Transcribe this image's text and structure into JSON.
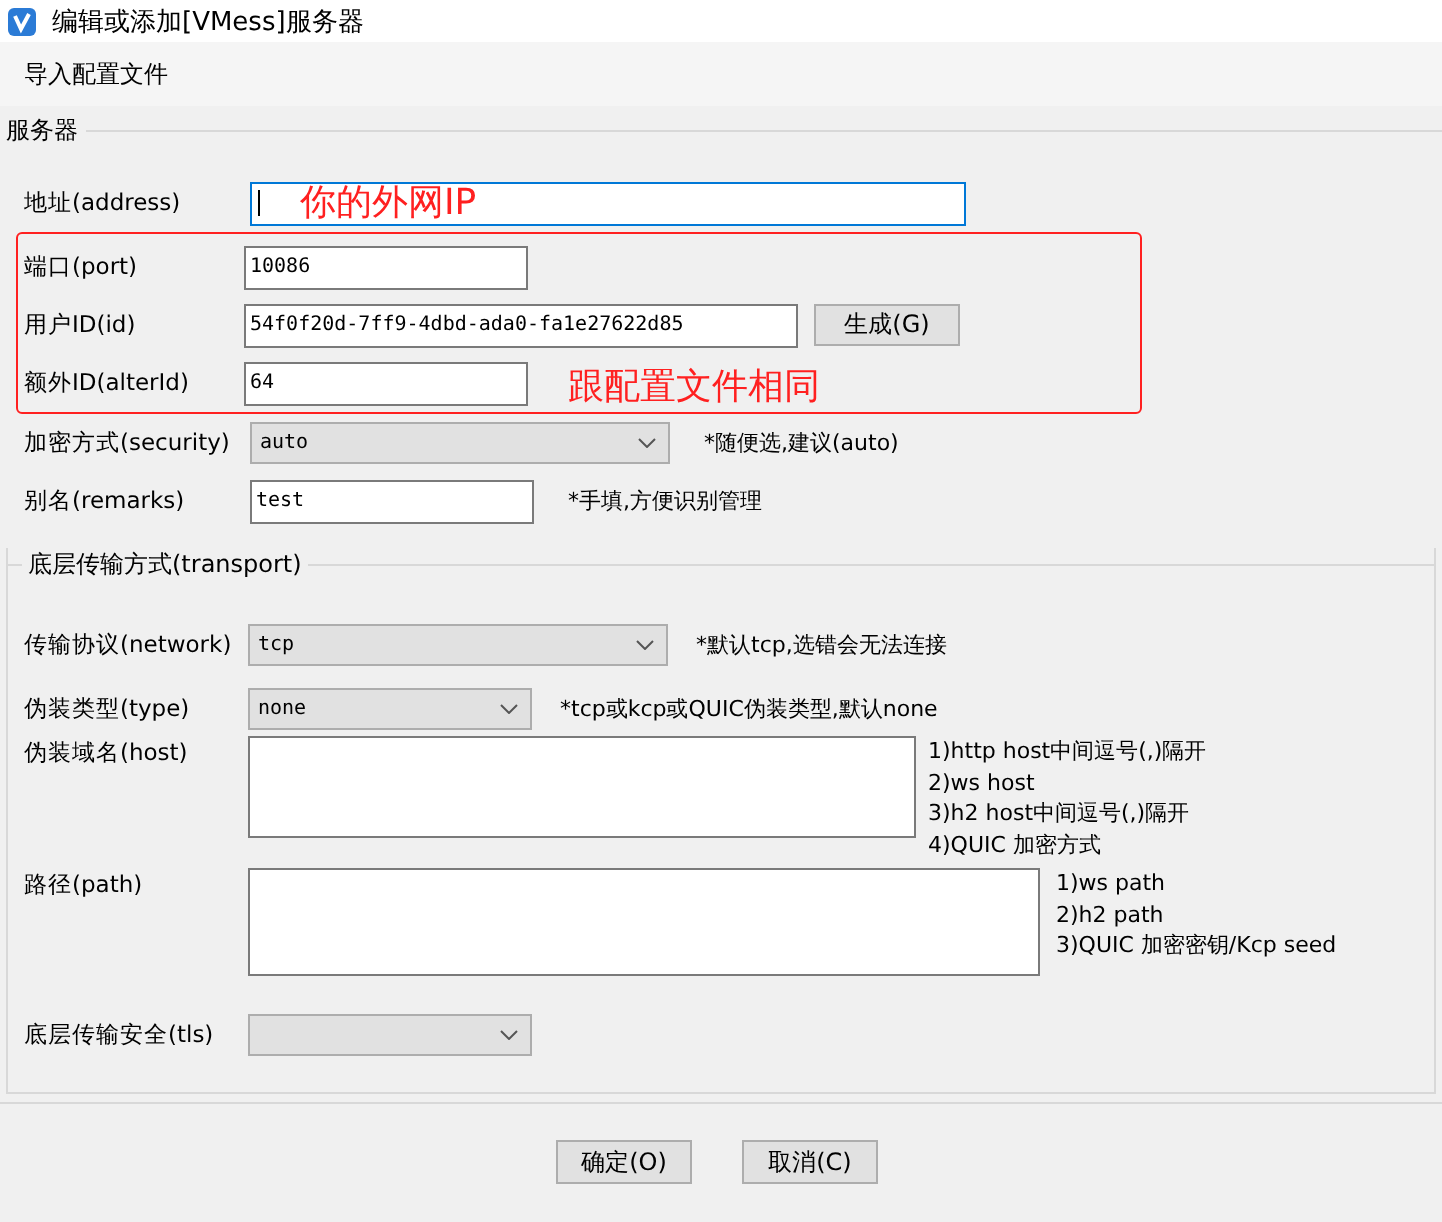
{
  "window": {
    "title": "编辑或添加[VMess]服务器"
  },
  "menu": [
    {
      "label": "导入配置文件"
    }
  ],
  "server": {
    "title": "服务器",
    "fields": [
      {
        "kind": "text",
        "label": "地址(address)",
        "focused": true,
        "note": "你的外网IP"
      },
      {
        "kind": "text",
        "label": "端口(port)",
        "value": "10086",
        "highlighted": true
      },
      {
        "kind": "text",
        "label": "用户ID(id)",
        "value": "54f0f20d-7ff9-4dbd-ada0-fa1e27622d85",
        "button": "生成(G)",
        "highlighted": true
      },
      {
        "kind": "text",
        "label": "额外ID(alterId)",
        "value": "64",
        "highlighted": true,
        "note": "跟配置文件相同"
      },
      {
        "kind": "select",
        "label": "加密方式(security)",
        "value": "auto",
        "hint": "*随便选,建议(auto)"
      },
      {
        "kind": "text",
        "label": "别名(remarks)",
        "value": "test",
        "hint": "*手填,方便识别管理"
      }
    ]
  },
  "transport": {
    "title": "底层传输方式(transport)",
    "fields": [
      {
        "kind": "select",
        "label": "传输协议(network)",
        "value": "tcp",
        "hint": "*默认tcp,选错会无法连接"
      },
      {
        "kind": "select",
        "label": "伪装类型(type)",
        "value": "none",
        "hint": "*tcp或kcp或QUIC伪装类型,默认none"
      },
      {
        "kind": "textarea",
        "label": "伪装域名(host)",
        "hints": [
          "1)http host中间逗号(,)隔开",
          "2)ws host",
          "3)h2 host中间逗号(,)隔开",
          "4)QUIC 加密方式"
        ]
      },
      {
        "kind": "textarea",
        "label": "路径(path)",
        "hints": [
          "1)ws path",
          "2)h2 path",
          "3)QUIC 加密密钥/Kcp seed"
        ]
      },
      {
        "kind": "select",
        "label": "底层传输安全(tls)"
      }
    ]
  },
  "buttons": [
    "确定(O)",
    "取消(C)"
  ]
}
